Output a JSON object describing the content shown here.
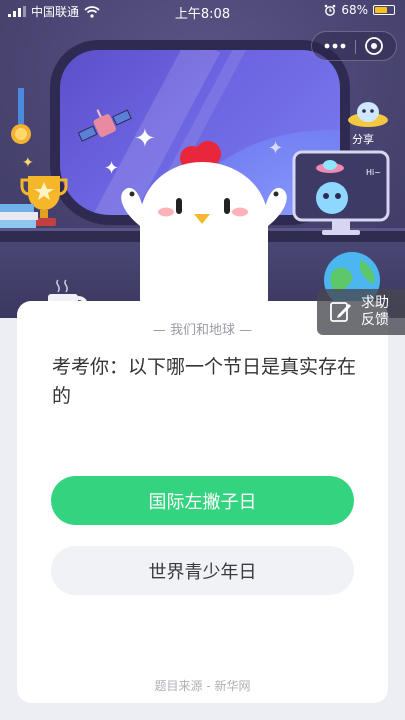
{
  "status_bar": {
    "carrier": "中国联通",
    "time": "上午8:08",
    "battery_percent": "68%",
    "battery_level": 0.68
  },
  "capsule": {
    "more_icon": "more-dots-icon",
    "close_icon": "close-circle-icon"
  },
  "scene": {
    "share_label": "分享",
    "monitor_text": "Hi~"
  },
  "help": {
    "line1": "求助",
    "line2": "反馈"
  },
  "quiz": {
    "subtitle": "— 我们和地球 —",
    "question": "考考你：以下哪一个节日是真实存在的",
    "options": [
      {
        "label": "国际左撇子日",
        "selected": true
      },
      {
        "label": "世界青少年日",
        "selected": false
      }
    ],
    "source": "题目来源 - 新华网"
  },
  "colors": {
    "accent_green": "#34d37f",
    "option_gray": "#f1f2f5",
    "scene_purple": "#4a4570"
  }
}
